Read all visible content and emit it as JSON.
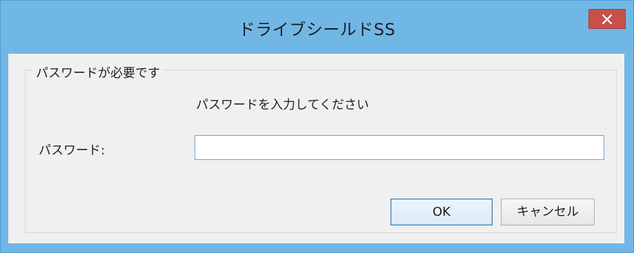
{
  "window": {
    "title": "ドライブシールドSS",
    "close_icon": "close-icon"
  },
  "group": {
    "legend": "パスワードが必要です"
  },
  "prompt": {
    "instruction": "パスワードを入力してください"
  },
  "password": {
    "label": "パスワード:",
    "value": ""
  },
  "buttons": {
    "ok_label": "OK",
    "cancel_label": "キャンセル"
  },
  "colors": {
    "frame": "#71b7e6",
    "close_button": "#c7504a",
    "client_background": "#f0f0f0"
  }
}
